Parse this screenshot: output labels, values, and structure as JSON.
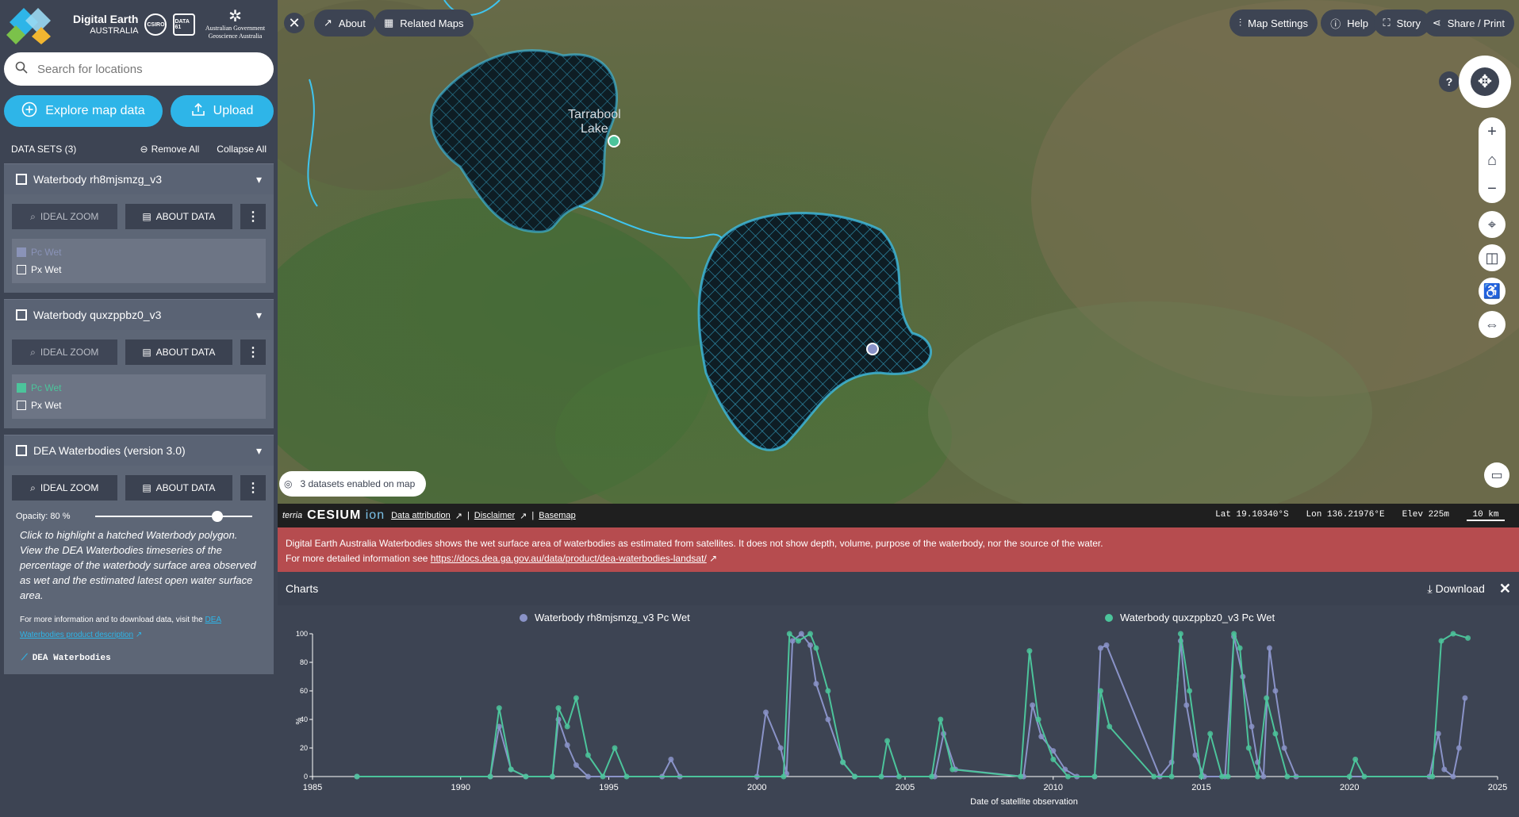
{
  "brand": {
    "name_line1": "Digital Earth",
    "name_line2": "AUSTRALIA",
    "partner_csiro": "CSIRO",
    "partner_data61": "DATA 61",
    "govt_line1": "Australian Government",
    "govt_line2": "Geoscience Australia"
  },
  "search": {
    "placeholder": "Search for locations"
  },
  "sidebar": {
    "explore_label": "Explore map data",
    "upload_label": "Upload",
    "datasets_title": "DATA SETS (3)",
    "remove_all": "Remove All",
    "collapse_all": "Collapse All",
    "workbench": [
      {
        "title": "Waterbody rh8mjsmzg_v3",
        "ideal_zoom": "IDEAL ZOOM",
        "about_data": "ABOUT DATA",
        "legend": [
          {
            "label": "Pc Wet",
            "state": "selected",
            "color": "#8a93b8"
          },
          {
            "label": "Px Wet",
            "state": "unchecked"
          }
        ]
      },
      {
        "title": "Waterbody quxzppbz0_v3",
        "ideal_zoom": "IDEAL ZOOM",
        "about_data": "ABOUT DATA",
        "legend": [
          {
            "label": "Pc Wet",
            "state": "selected",
            "color": "#4cc49b"
          },
          {
            "label": "Px Wet",
            "state": "unchecked"
          }
        ]
      },
      {
        "title": "DEA Waterbodies (version 3.0)",
        "ideal_zoom": "IDEAL ZOOM",
        "about_data": "ABOUT DATA",
        "opacity_label": "Opacity: 80 %",
        "opacity_value": 0.8,
        "description": "Click to highlight a hatched Waterbody polygon. View the DEA Waterbodies timeseries of the percentage of the waterbody surface area observed as wet and the estimated latest open water surface area.",
        "more_info_prefix": "For more information and to download data, visit the ",
        "more_info_link": "DEA Waterbodies product description",
        "legend_label": "DEA Waterbodies"
      }
    ]
  },
  "map": {
    "about_label": "About",
    "related_maps_label": "Related Maps",
    "map_settings_label": "Map Settings",
    "help_label": "Help",
    "story_label": "Story",
    "share_label": "Share / Print",
    "lake_label_line1": "Tarrabool",
    "lake_label_line2": "Lake",
    "datasets_enabled": "3 datasets enabled on map",
    "help_q": "?"
  },
  "status_bar": {
    "terria": "terria",
    "cesium": "CESIUM",
    "ion": "ion",
    "data_attribution": "Data attribution",
    "disclaimer": "Disclaimer",
    "basemap": "Basemap",
    "lat": "Lat  19.10340°S",
    "lon": "Lon  136.21976°E",
    "elev": "Elev  225m",
    "scale": "10 km"
  },
  "banner": {
    "line1": "Digital Earth Australia Waterbodies shows the wet surface area of waterbodies as estimated from satellites. It does not show depth, volume, purpose of the waterbody, nor the source of the water.",
    "line2_prefix": "For more detailed information see ",
    "link": "https://docs.dea.ga.gov.au/data/product/dea-waterbodies-landsat/"
  },
  "charts_panel": {
    "title": "Charts",
    "download_label": "Download"
  },
  "chart_data": {
    "type": "line",
    "xlabel": "Date of satellite observation",
    "ylabel": "%",
    "xlim": [
      1985,
      2025
    ],
    "ylim": [
      0,
      100
    ],
    "x_ticks": [
      "1985",
      "1990",
      "1995",
      "2000",
      "2005",
      "2010",
      "2015",
      "2020",
      "2025"
    ],
    "y_ticks": [
      "0",
      "20",
      "40",
      "60",
      "80",
      "100"
    ],
    "legend_placement": "top",
    "series": [
      {
        "name": "Waterbody rh8mjsmzg_v3 Pc Wet",
        "color": "#8a93c8",
        "points": [
          [
            1986.5,
            0
          ],
          [
            1991.0,
            0
          ],
          [
            1991.3,
            35
          ],
          [
            1991.7,
            5
          ],
          [
            1992.2,
            0
          ],
          [
            1993.1,
            0
          ],
          [
            1993.3,
            40
          ],
          [
            1993.6,
            22
          ],
          [
            1993.9,
            8
          ],
          [
            1994.3,
            0
          ],
          [
            1996.8,
            0
          ],
          [
            1997.1,
            12
          ],
          [
            1997.4,
            0
          ],
          [
            2000.0,
            0
          ],
          [
            2000.3,
            45
          ],
          [
            2000.8,
            20
          ],
          [
            2001.0,
            2
          ],
          [
            2001.2,
            95
          ],
          [
            2001.5,
            100
          ],
          [
            2001.8,
            92
          ],
          [
            2002.0,
            65
          ],
          [
            2002.4,
            40
          ],
          [
            2002.9,
            10
          ],
          [
            2003.3,
            0
          ],
          [
            2006.0,
            0
          ],
          [
            2006.3,
            30
          ],
          [
            2006.7,
            5
          ],
          [
            2009.0,
            0
          ],
          [
            2009.3,
            50
          ],
          [
            2009.6,
            28
          ],
          [
            2010.0,
            18
          ],
          [
            2010.4,
            5
          ],
          [
            2010.8,
            0
          ],
          [
            2011.4,
            0
          ],
          [
            2011.6,
            90
          ],
          [
            2011.8,
            92
          ],
          [
            2013.6,
            0
          ],
          [
            2014.0,
            10
          ],
          [
            2014.3,
            95
          ],
          [
            2014.5,
            50
          ],
          [
            2014.8,
            15
          ],
          [
            2015.1,
            0
          ],
          [
            2015.8,
            0
          ],
          [
            2016.1,
            98
          ],
          [
            2016.4,
            70
          ],
          [
            2016.7,
            35
          ],
          [
            2016.9,
            10
          ],
          [
            2017.1,
            0
          ],
          [
            2017.3,
            90
          ],
          [
            2017.5,
            60
          ],
          [
            2017.8,
            20
          ],
          [
            2018.2,
            0
          ],
          [
            2022.7,
            0
          ],
          [
            2023.0,
            30
          ],
          [
            2023.2,
            5
          ],
          [
            2023.5,
            0
          ],
          [
            2023.7,
            20
          ],
          [
            2023.9,
            55
          ]
        ]
      },
      {
        "name": "Waterbody quxzppbz0_v3 Pc Wet",
        "color": "#4cc49b",
        "points": [
          [
            1986.5,
            0
          ],
          [
            1991.0,
            0
          ],
          [
            1991.3,
            48
          ],
          [
            1991.7,
            5
          ],
          [
            1992.2,
            0
          ],
          [
            1993.1,
            0
          ],
          [
            1993.3,
            48
          ],
          [
            1993.6,
            35
          ],
          [
            1993.9,
            55
          ],
          [
            1994.3,
            15
          ],
          [
            1994.8,
            0
          ],
          [
            1995.2,
            20
          ],
          [
            1995.6,
            0
          ],
          [
            2000.9,
            0
          ],
          [
            2001.1,
            100
          ],
          [
            2001.4,
            95
          ],
          [
            2001.8,
            100
          ],
          [
            2002.0,
            90
          ],
          [
            2002.4,
            60
          ],
          [
            2002.9,
            10
          ],
          [
            2003.3,
            0
          ],
          [
            2004.2,
            0
          ],
          [
            2004.4,
            25
          ],
          [
            2004.8,
            0
          ],
          [
            2005.9,
            0
          ],
          [
            2006.2,
            40
          ],
          [
            2006.6,
            5
          ],
          [
            2008.9,
            0
          ],
          [
            2009.2,
            88
          ],
          [
            2009.5,
            40
          ],
          [
            2010.0,
            12
          ],
          [
            2010.5,
            0
          ],
          [
            2011.4,
            0
          ],
          [
            2011.6,
            60
          ],
          [
            2011.9,
            35
          ],
          [
            2013.4,
            0
          ],
          [
            2014.0,
            0
          ],
          [
            2014.3,
            100
          ],
          [
            2014.6,
            60
          ],
          [
            2015.0,
            0
          ],
          [
            2015.3,
            30
          ],
          [
            2015.7,
            0
          ],
          [
            2015.9,
            0
          ],
          [
            2016.1,
            100
          ],
          [
            2016.3,
            90
          ],
          [
            2016.6,
            20
          ],
          [
            2016.9,
            0
          ],
          [
            2017.2,
            55
          ],
          [
            2017.5,
            30
          ],
          [
            2017.9,
            0
          ],
          [
            2020.0,
            0
          ],
          [
            2020.2,
            12
          ],
          [
            2020.5,
            0
          ],
          [
            2022.8,
            0
          ],
          [
            2023.1,
            95
          ],
          [
            2023.5,
            100
          ],
          [
            2024.0,
            97
          ]
        ]
      }
    ]
  }
}
